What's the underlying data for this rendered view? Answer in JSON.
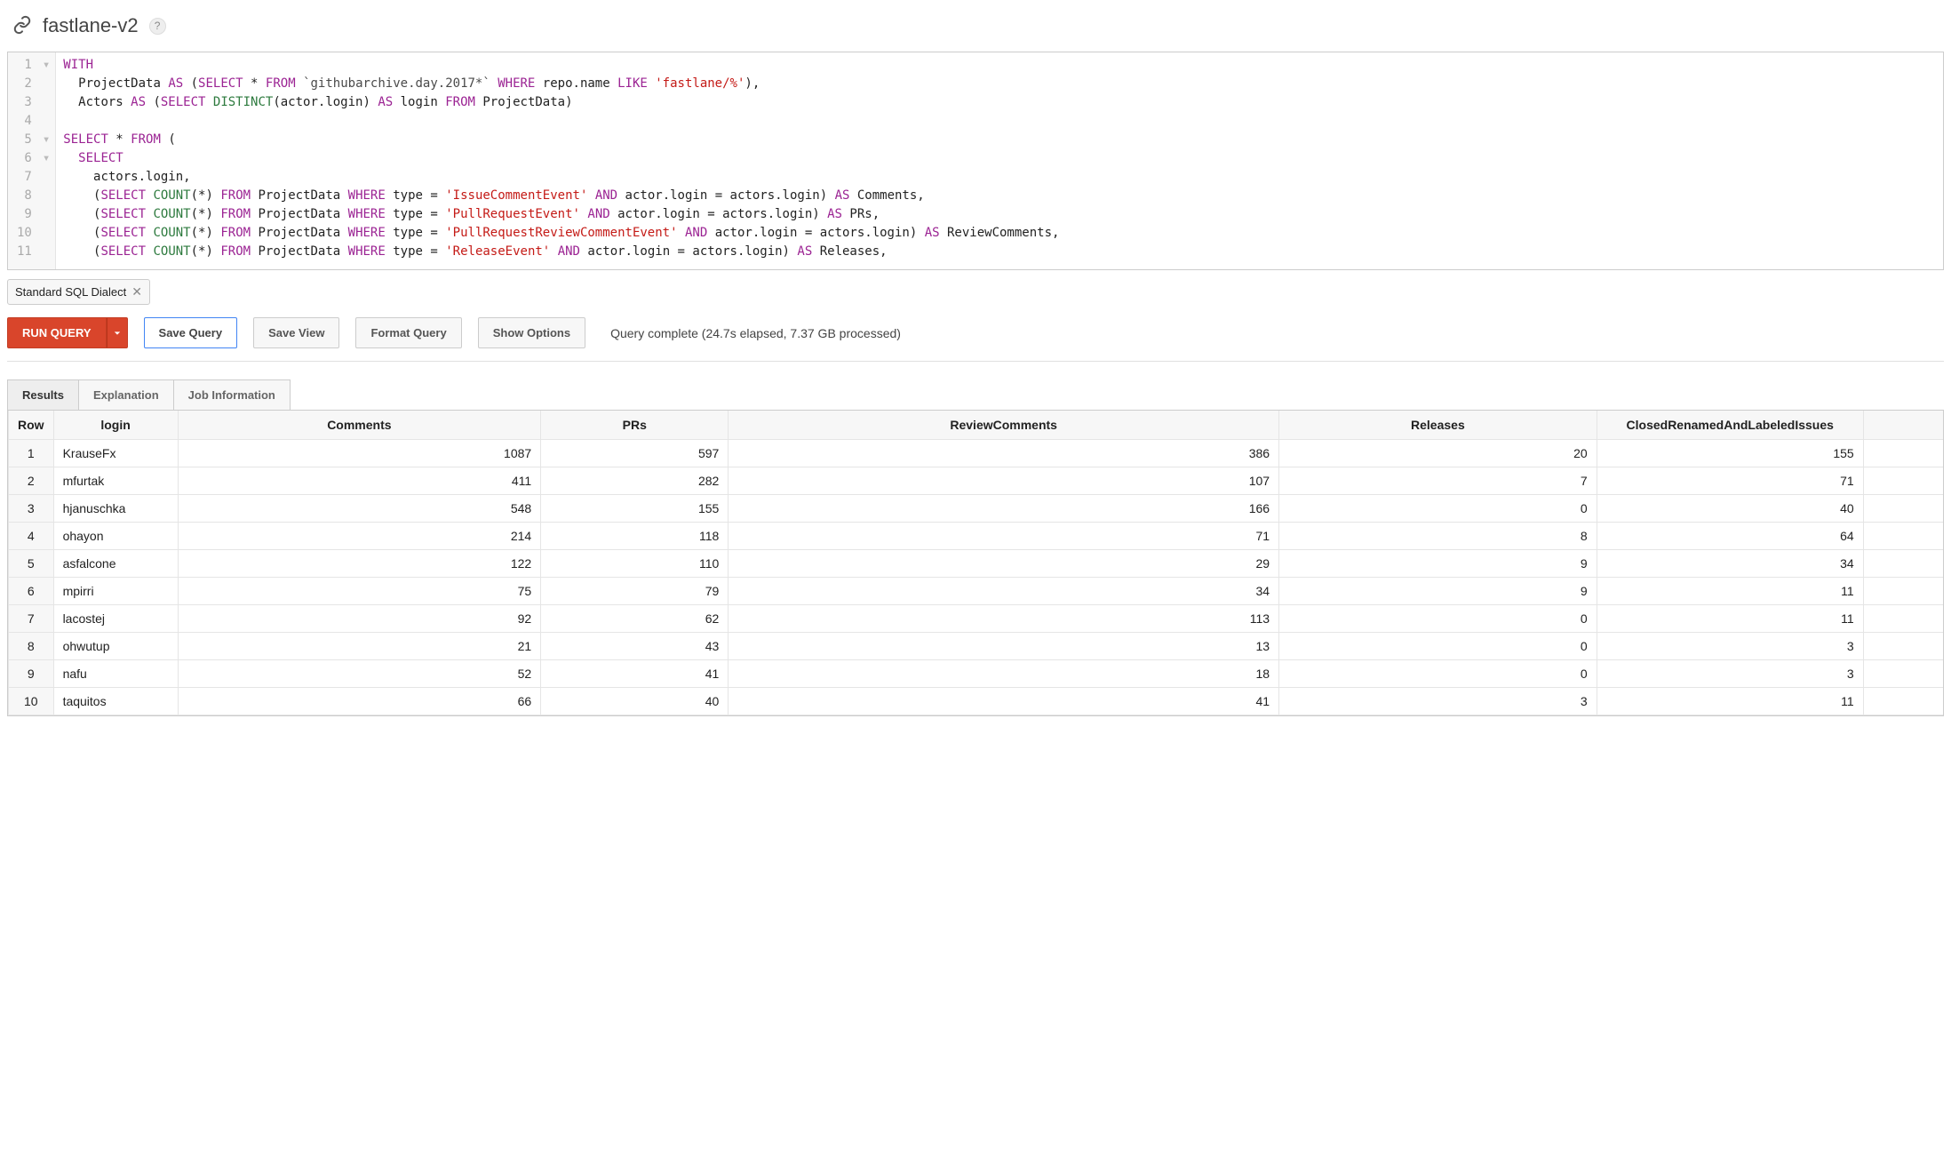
{
  "header": {
    "title": "fastlane-v2"
  },
  "editor": {
    "lines": [
      {
        "n": 1,
        "fold": "▾",
        "tokens": [
          [
            "kw",
            "WITH"
          ]
        ]
      },
      {
        "n": 2,
        "fold": " ",
        "tokens": [
          [
            "plain",
            "  ProjectData "
          ],
          [
            "kw",
            "AS"
          ],
          [
            "plain",
            " ("
          ],
          [
            "kw",
            "SELECT"
          ],
          [
            "plain",
            " * "
          ],
          [
            "kw",
            "FROM"
          ],
          [
            "plain",
            " "
          ],
          [
            "bt",
            "`githubarchive.day.2017*`"
          ],
          [
            "plain",
            " "
          ],
          [
            "kw",
            "WHERE"
          ],
          [
            "plain",
            " repo.name "
          ],
          [
            "kw",
            "LIKE"
          ],
          [
            "plain",
            " "
          ],
          [
            "str",
            "'fastlane/%'"
          ],
          [
            "plain",
            "),"
          ]
        ]
      },
      {
        "n": 3,
        "fold": " ",
        "tokens": [
          [
            "plain",
            "  Actors "
          ],
          [
            "kw",
            "AS"
          ],
          [
            "plain",
            " ("
          ],
          [
            "kw",
            "SELECT"
          ],
          [
            "plain",
            " "
          ],
          [
            "fn",
            "DISTINCT"
          ],
          [
            "plain",
            "(actor.login) "
          ],
          [
            "kw",
            "AS"
          ],
          [
            "plain",
            " login "
          ],
          [
            "kw",
            "FROM"
          ],
          [
            "plain",
            " ProjectData)"
          ]
        ]
      },
      {
        "n": 4,
        "fold": " ",
        "tokens": [
          [
            "plain",
            ""
          ]
        ]
      },
      {
        "n": 5,
        "fold": "▾",
        "tokens": [
          [
            "kw",
            "SELECT"
          ],
          [
            "plain",
            " * "
          ],
          [
            "kw",
            "FROM"
          ],
          [
            "plain",
            " ("
          ]
        ]
      },
      {
        "n": 6,
        "fold": "▾",
        "tokens": [
          [
            "plain",
            "  "
          ],
          [
            "kw",
            "SELECT"
          ]
        ]
      },
      {
        "n": 7,
        "fold": " ",
        "tokens": [
          [
            "plain",
            "    actors.login,"
          ]
        ]
      },
      {
        "n": 8,
        "fold": " ",
        "tokens": [
          [
            "plain",
            "    ("
          ],
          [
            "kw",
            "SELECT"
          ],
          [
            "plain",
            " "
          ],
          [
            "fn",
            "COUNT"
          ],
          [
            "plain",
            "(*) "
          ],
          [
            "kw",
            "FROM"
          ],
          [
            "plain",
            " ProjectData "
          ],
          [
            "kw",
            "WHERE"
          ],
          [
            "plain",
            " type = "
          ],
          [
            "str",
            "'IssueCommentEvent'"
          ],
          [
            "plain",
            " "
          ],
          [
            "kw",
            "AND"
          ],
          [
            "plain",
            " actor.login = actors.login) "
          ],
          [
            "kw",
            "AS"
          ],
          [
            "plain",
            " Comments,"
          ]
        ]
      },
      {
        "n": 9,
        "fold": " ",
        "tokens": [
          [
            "plain",
            "    ("
          ],
          [
            "kw",
            "SELECT"
          ],
          [
            "plain",
            " "
          ],
          [
            "fn",
            "COUNT"
          ],
          [
            "plain",
            "(*) "
          ],
          [
            "kw",
            "FROM"
          ],
          [
            "plain",
            " ProjectData "
          ],
          [
            "kw",
            "WHERE"
          ],
          [
            "plain",
            " type = "
          ],
          [
            "str",
            "'PullRequestEvent'"
          ],
          [
            "plain",
            " "
          ],
          [
            "kw",
            "AND"
          ],
          [
            "plain",
            " actor.login = actors.login) "
          ],
          [
            "kw",
            "AS"
          ],
          [
            "plain",
            " PRs,"
          ]
        ]
      },
      {
        "n": 10,
        "fold": " ",
        "tokens": [
          [
            "plain",
            "    ("
          ],
          [
            "kw",
            "SELECT"
          ],
          [
            "plain",
            " "
          ],
          [
            "fn",
            "COUNT"
          ],
          [
            "plain",
            "(*) "
          ],
          [
            "kw",
            "FROM"
          ],
          [
            "plain",
            " ProjectData "
          ],
          [
            "kw",
            "WHERE"
          ],
          [
            "plain",
            " type = "
          ],
          [
            "str",
            "'PullRequestReviewCommentEvent'"
          ],
          [
            "plain",
            " "
          ],
          [
            "kw",
            "AND"
          ],
          [
            "plain",
            " actor.login = actors.login) "
          ],
          [
            "kw",
            "AS"
          ],
          [
            "plain",
            " ReviewComments,"
          ]
        ]
      },
      {
        "n": 11,
        "fold": " ",
        "tokens": [
          [
            "plain",
            "    ("
          ],
          [
            "kw",
            "SELECT"
          ],
          [
            "plain",
            " "
          ],
          [
            "fn",
            "COUNT"
          ],
          [
            "plain",
            "(*) "
          ],
          [
            "kw",
            "FROM"
          ],
          [
            "plain",
            " ProjectData "
          ],
          [
            "kw",
            "WHERE"
          ],
          [
            "plain",
            " type = "
          ],
          [
            "str",
            "'ReleaseEvent'"
          ],
          [
            "plain",
            " "
          ],
          [
            "kw",
            "AND"
          ],
          [
            "plain",
            " actor.login = actors.login) "
          ],
          [
            "kw",
            "AS"
          ],
          [
            "plain",
            " Releases,"
          ]
        ]
      }
    ]
  },
  "chip": {
    "label": "Standard SQL Dialect"
  },
  "toolbar": {
    "run": "RUN QUERY",
    "save_query": "Save Query",
    "save_view": "Save View",
    "format": "Format Query",
    "show_options": "Show Options",
    "status": "Query complete (24.7s elapsed, 7.37 GB processed)"
  },
  "tabs": {
    "results": "Results",
    "explanation": "Explanation",
    "job_info": "Job Information"
  },
  "results": {
    "columns": [
      "Row",
      "login",
      "Comments",
      "PRs",
      "ReviewComments",
      "Releases",
      "ClosedRenamedAndLabeledIssues"
    ],
    "rows": [
      {
        "row": 1,
        "login": "KrauseFx",
        "Comments": 1087,
        "PRs": 597,
        "ReviewComments": 386,
        "Releases": 20,
        "ClosedRenamedAndLabeledIssues": 155
      },
      {
        "row": 2,
        "login": "mfurtak",
        "Comments": 411,
        "PRs": 282,
        "ReviewComments": 107,
        "Releases": 7,
        "ClosedRenamedAndLabeledIssues": 71
      },
      {
        "row": 3,
        "login": "hjanuschka",
        "Comments": 548,
        "PRs": 155,
        "ReviewComments": 166,
        "Releases": 0,
        "ClosedRenamedAndLabeledIssues": 40
      },
      {
        "row": 4,
        "login": "ohayon",
        "Comments": 214,
        "PRs": 118,
        "ReviewComments": 71,
        "Releases": 8,
        "ClosedRenamedAndLabeledIssues": 64
      },
      {
        "row": 5,
        "login": "asfalcone",
        "Comments": 122,
        "PRs": 110,
        "ReviewComments": 29,
        "Releases": 9,
        "ClosedRenamedAndLabeledIssues": 34
      },
      {
        "row": 6,
        "login": "mpirri",
        "Comments": 75,
        "PRs": 79,
        "ReviewComments": 34,
        "Releases": 9,
        "ClosedRenamedAndLabeledIssues": 11
      },
      {
        "row": 7,
        "login": "lacostej",
        "Comments": 92,
        "PRs": 62,
        "ReviewComments": 113,
        "Releases": 0,
        "ClosedRenamedAndLabeledIssues": 11
      },
      {
        "row": 8,
        "login": "ohwutup",
        "Comments": 21,
        "PRs": 43,
        "ReviewComments": 13,
        "Releases": 0,
        "ClosedRenamedAndLabeledIssues": 3
      },
      {
        "row": 9,
        "login": "nafu",
        "Comments": 52,
        "PRs": 41,
        "ReviewComments": 18,
        "Releases": 0,
        "ClosedRenamedAndLabeledIssues": 3
      },
      {
        "row": 10,
        "login": "taquitos",
        "Comments": 66,
        "PRs": 40,
        "ReviewComments": 41,
        "Releases": 3,
        "ClosedRenamedAndLabeledIssues": 11
      }
    ]
  }
}
